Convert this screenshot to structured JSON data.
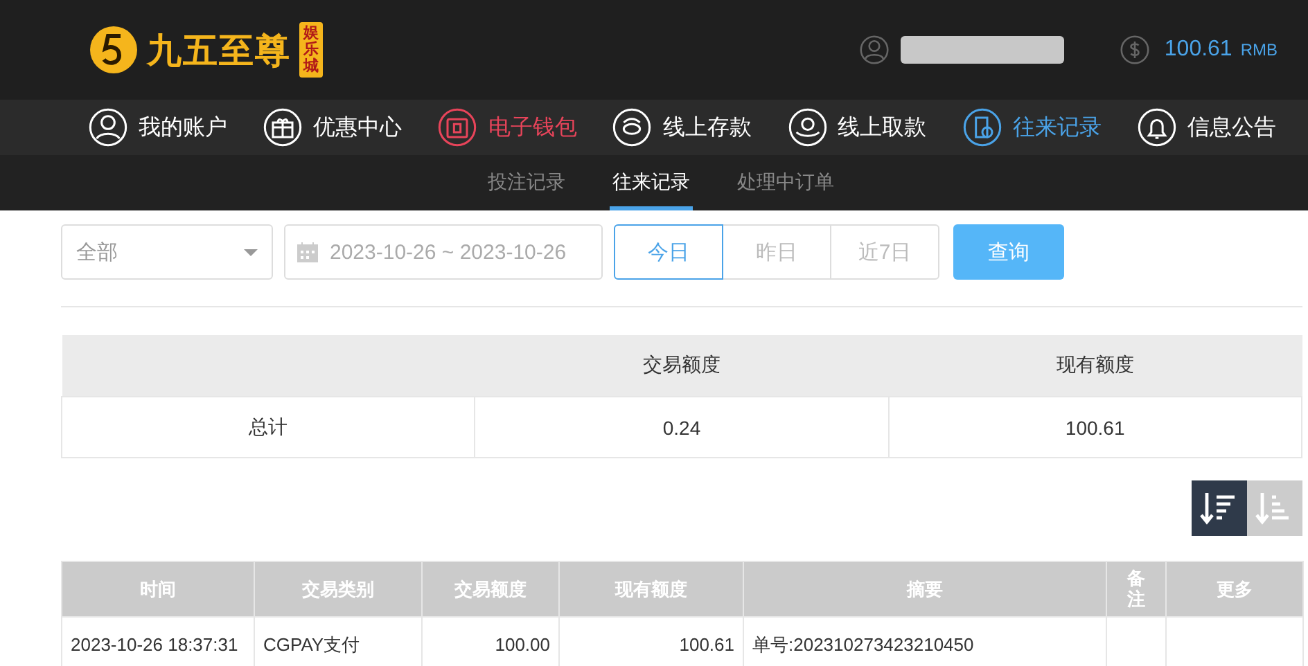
{
  "header": {
    "logo_text": "九五至尊",
    "logo_badge": "娱乐城",
    "balance": "100.61",
    "currency": "RMB"
  },
  "nav": [
    {
      "label": "我的账户",
      "kind": "user",
      "color": "#ffffff"
    },
    {
      "label": "优惠中心",
      "kind": "gift",
      "color": "#ffffff"
    },
    {
      "label": "电子钱包",
      "kind": "wallet",
      "color": "#e8445a"
    },
    {
      "label": "线上存款",
      "kind": "deposit",
      "color": "#ffffff"
    },
    {
      "label": "线上取款",
      "kind": "withdraw",
      "color": "#ffffff"
    },
    {
      "label": "往来记录",
      "kind": "record",
      "color": "#4aa3e8"
    },
    {
      "label": "信息公告",
      "kind": "bell",
      "color": "#ffffff"
    }
  ],
  "subnav": [
    {
      "label": "投注记录",
      "selected": false
    },
    {
      "label": "往来记录",
      "selected": true
    },
    {
      "label": "处理中订单",
      "selected": false
    }
  ],
  "filters": {
    "type_select": "全部",
    "date_range": "2023-10-26 ~ 2023-10-26",
    "quick_ranges": [
      {
        "label": "今日",
        "selected": true
      },
      {
        "label": "昨日",
        "selected": false
      },
      {
        "label": "近7日",
        "selected": false
      }
    ],
    "query_button": "查询"
  },
  "summary": {
    "columns": [
      "",
      "交易额度",
      "现有额度"
    ],
    "rows": [
      [
        "总计",
        "0.24",
        "100.61"
      ]
    ]
  },
  "sort_buttons": [
    {
      "kind": "desc",
      "selected": true
    },
    {
      "kind": "asc",
      "selected": false
    }
  ],
  "records": {
    "columns": [
      "时间",
      "交易类别",
      "交易额度",
      "现有额度",
      "摘要",
      "备注",
      "更多"
    ],
    "rows": [
      [
        "2023-10-26 18:37:31",
        "CGPAY支付",
        "100.00",
        "100.61",
        "单号:202310273423210450",
        "",
        ""
      ]
    ]
  }
}
